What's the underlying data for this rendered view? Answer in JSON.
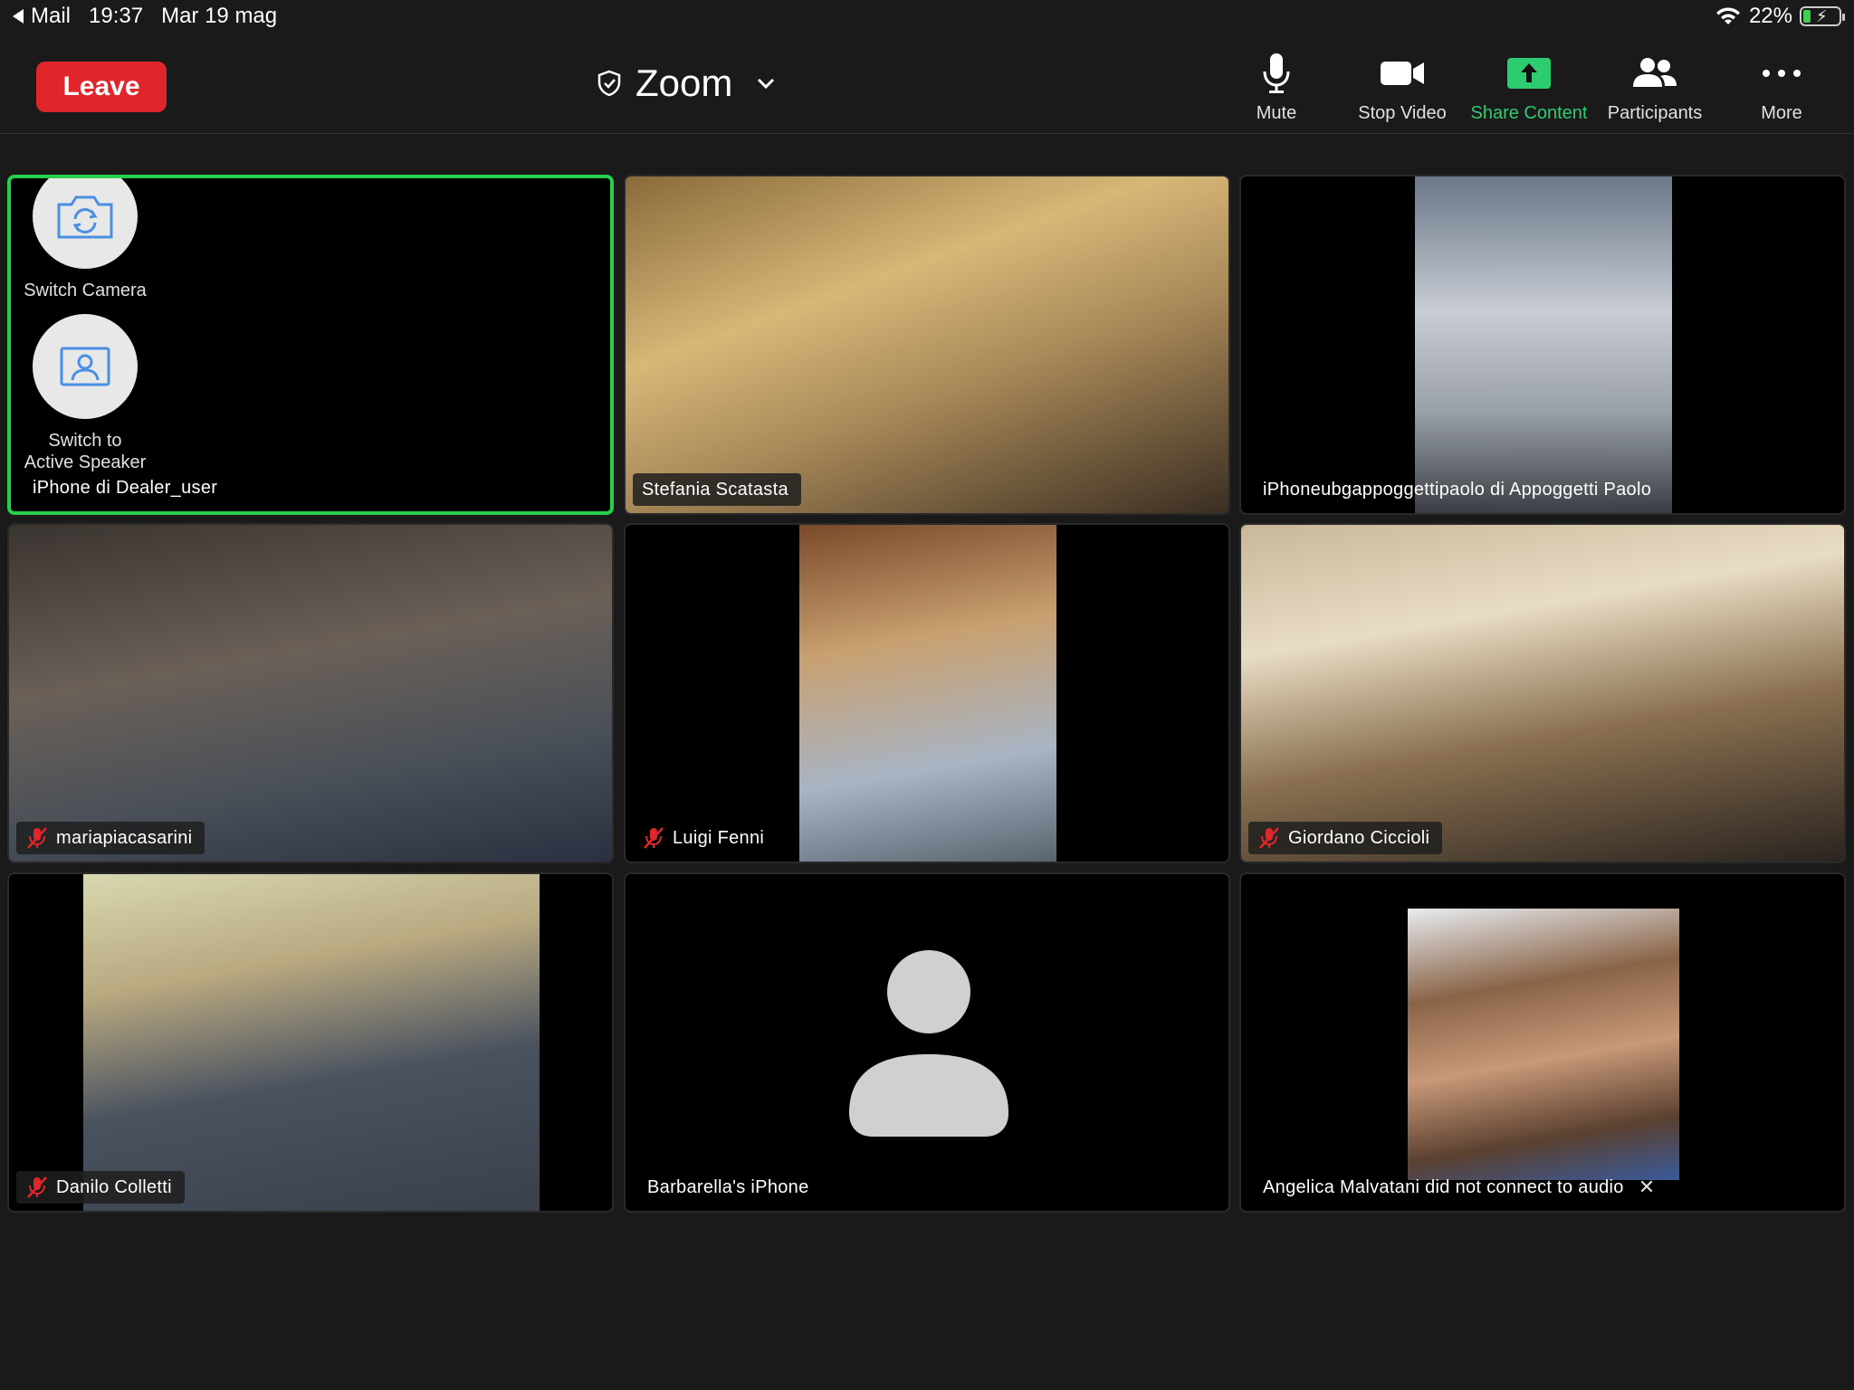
{
  "statusbar": {
    "back_app": "Mail",
    "time": "19:37",
    "date": "Mar 19 mag",
    "battery": "22%",
    "battery_level": 0.22
  },
  "toolbar": {
    "leave_label": "Leave",
    "title": "Zoom",
    "mute_label": "Mute",
    "stop_video_label": "Stop Video",
    "share_label": "Share Content",
    "participants_label": "Participants",
    "more_label": "More",
    "accent_red": "#e0262b",
    "accent_green": "#2ecc71"
  },
  "self_tile": {
    "switch_camera_label": "Switch Camera",
    "switch_speaker_line1": "Switch to",
    "switch_speaker_line2": "Active Speaker",
    "name": "iPhone di Dealer_user"
  },
  "participants": [
    {
      "name": "Stefania Scatasta",
      "muted": false
    },
    {
      "name": "iPhoneubgappoggettipaolo di Appoggetti Paolo",
      "muted": false
    },
    {
      "name": "mariapiacasarini",
      "muted": true
    },
    {
      "name": "Luigi Fenni",
      "muted": true
    },
    {
      "name": "Giordano Ciccioli",
      "muted": true
    },
    {
      "name": "Danilo Colletti",
      "muted": true
    },
    {
      "name": "Barbarella's iPhone",
      "muted": false
    },
    {
      "name": "Angelica Malvatani did not connect to audio",
      "muted": false
    }
  ]
}
